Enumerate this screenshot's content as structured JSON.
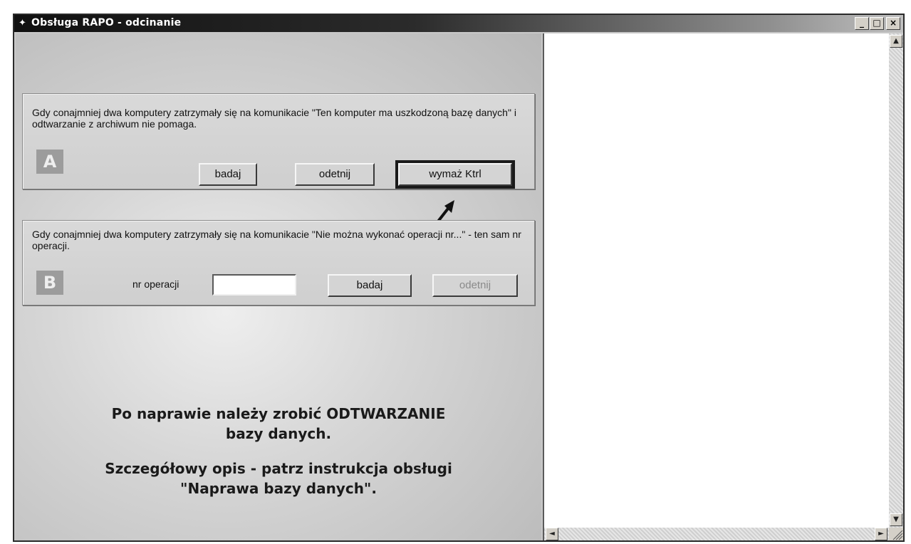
{
  "window": {
    "title": "Obsługa RAPO - odcinanie",
    "controls": {
      "minimize": "_",
      "maximize": "□",
      "close": "×"
    }
  },
  "group_a": {
    "badge": "A",
    "description": "Gdy conajmniej dwa komputery zatrzymały się na komunikacie \"Ten komputer ma uszkodzoną bazę danych\" i odtwarzanie z archiwum nie pomaga.",
    "buttons": {
      "badaj": "badaj",
      "odetnij": "odetnij",
      "wymaz": "wymaż Ktrl"
    }
  },
  "group_b": {
    "badge": "B",
    "description": "Gdy conajmniej dwa komputery zatrzymały się na komunikacie \"Nie można wykonać operacji nr...\" - ten sam nr operacji.",
    "nr_label": "nr operacji",
    "nr_value": "",
    "buttons": {
      "badaj": "badaj",
      "odetnij": "odetnij"
    }
  },
  "notes": {
    "line1": "Po naprawie należy zrobić ODTWARZANIE",
    "line2": "bazy danych.",
    "line3": "Szczegółowy opis - patrz instrukcja obsługi",
    "line4": "\"Naprawa bazy danych\"."
  },
  "scrollbar": {
    "up": "▲",
    "down": "▼",
    "left": "◄",
    "right": "►"
  }
}
